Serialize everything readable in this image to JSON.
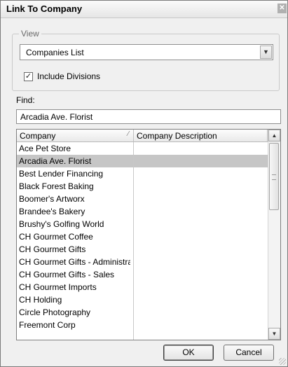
{
  "dialog": {
    "title": "Link To Company",
    "close_glyph": "✕"
  },
  "view": {
    "group_label": "View",
    "selected_option": "Companies List",
    "include_divisions_label": "Include Divisions",
    "include_divisions_checked": true
  },
  "find": {
    "label": "Find:",
    "value": "Arcadia Ave. Florist"
  },
  "list": {
    "columns": [
      "Company",
      "Company Description"
    ],
    "sort_indicator": "⁄",
    "rows": [
      {
        "company": "Ace Pet Store",
        "description": ""
      },
      {
        "company": "Arcadia Ave. Florist",
        "description": "",
        "selected": true
      },
      {
        "company": "Best Lender Financing",
        "description": ""
      },
      {
        "company": "Black Forest Baking",
        "description": ""
      },
      {
        "company": "Boomer's Artworx",
        "description": ""
      },
      {
        "company": "Brandee's Bakery",
        "description": ""
      },
      {
        "company": "Brushy's Golfing World",
        "description": ""
      },
      {
        "company": "CH Gourmet Coffee",
        "description": ""
      },
      {
        "company": "CH Gourmet Gifts",
        "description": ""
      },
      {
        "company": "CH Gourmet Gifts - Administra",
        "description": ""
      },
      {
        "company": "CH Gourmet Gifts - Sales",
        "description": ""
      },
      {
        "company": "CH Gourmet Imports",
        "description": ""
      },
      {
        "company": "CH Holding",
        "description": ""
      },
      {
        "company": "Circle Photography",
        "description": ""
      },
      {
        "company": "Freemont Corp",
        "description": ""
      }
    ]
  },
  "buttons": {
    "ok": "OK",
    "cancel": "Cancel"
  }
}
